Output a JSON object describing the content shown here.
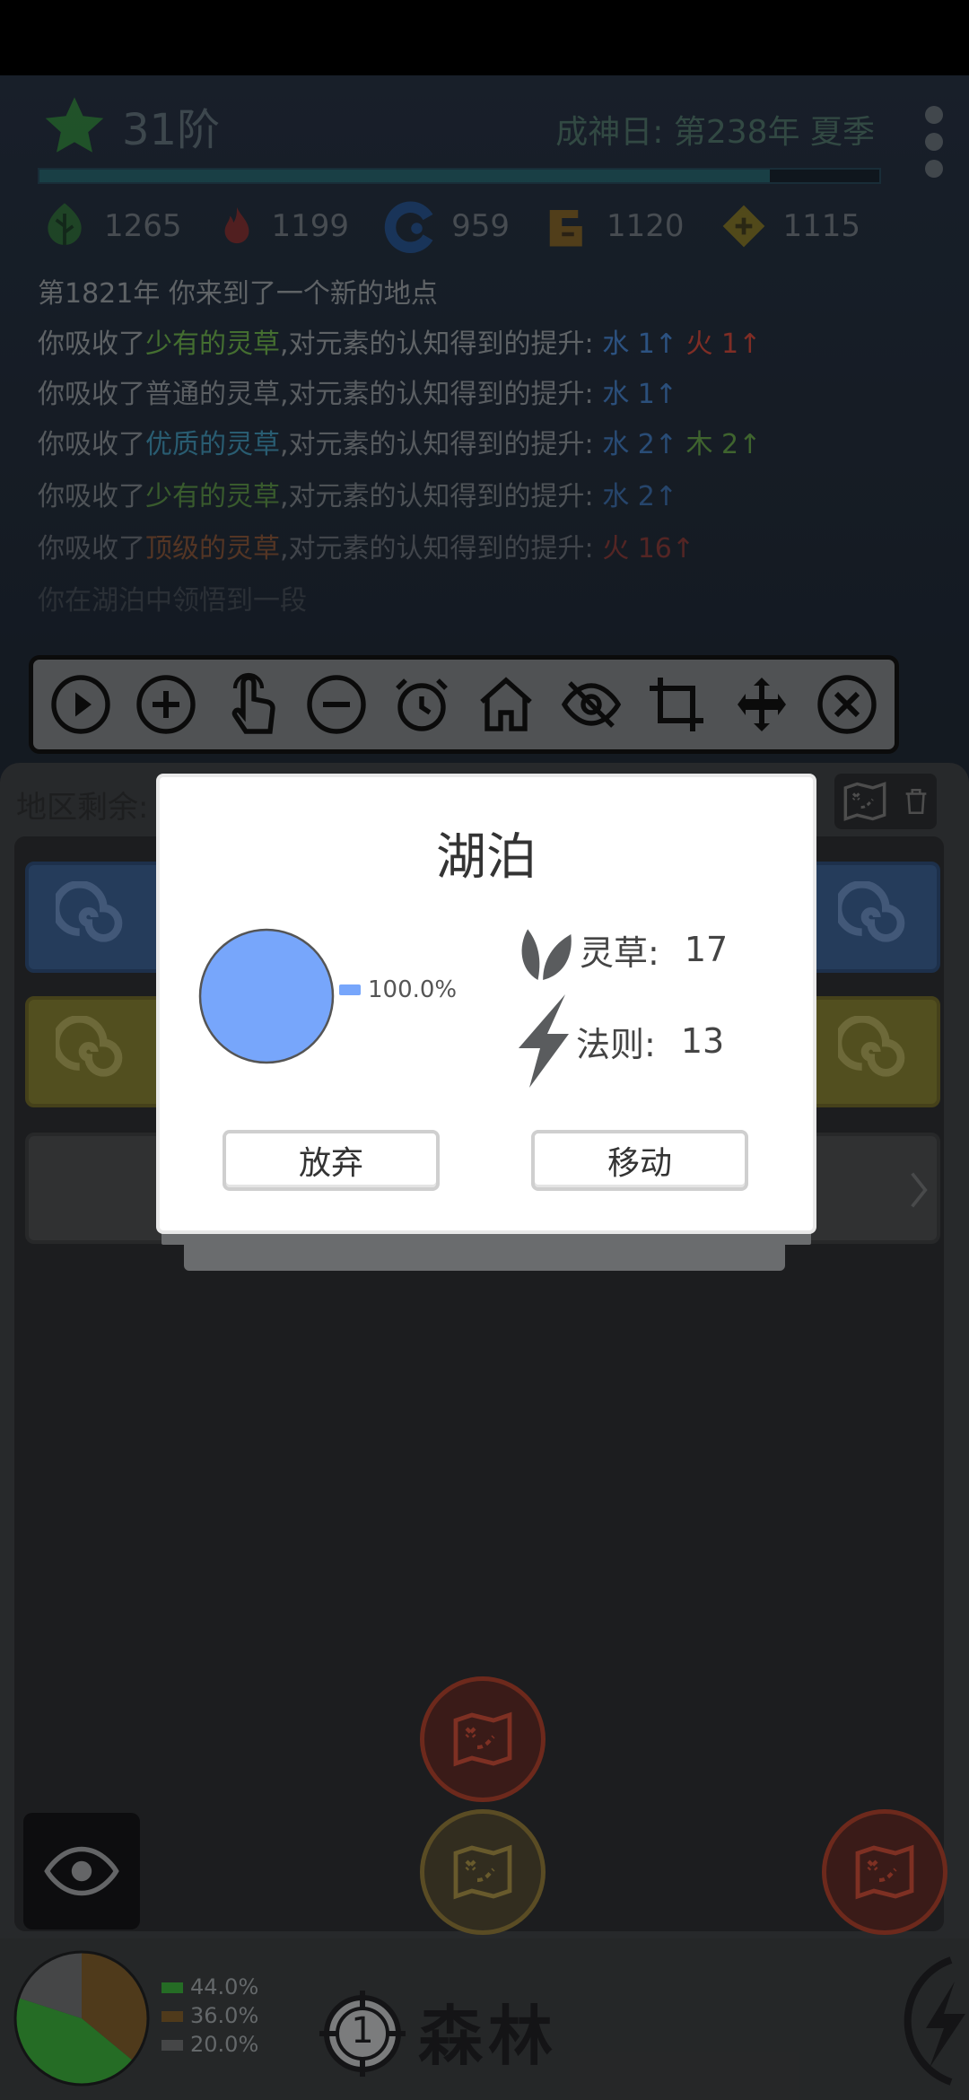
{
  "header": {
    "rank_label": "31阶",
    "date_label": "成神日: 第238年 夏季",
    "progress": 0.87
  },
  "resources": [
    {
      "icon": "green-leaf-icon",
      "value": "1265",
      "color": "#3a9a3a"
    },
    {
      "icon": "red-flame-icon",
      "value": "1199",
      "color": "#c7322a"
    },
    {
      "icon": "blue-water-icon",
      "value": "959",
      "color": "#2a6fc7"
    },
    {
      "icon": "orange-earth-icon",
      "value": "1120",
      "color": "#c78a1a"
    },
    {
      "icon": "yellow-diamond-icon",
      "value": "1115",
      "color": "#c7a91a"
    }
  ],
  "log": [
    {
      "parts": [
        {
          "t": "第1821年 你来到了一个新的地点",
          "c": ""
        }
      ]
    },
    {
      "parts": [
        {
          "t": "你吸收了",
          "c": ""
        },
        {
          "t": "少有的灵草",
          "c": "g"
        },
        {
          "t": ",对元素的认知得到的提升: ",
          "c": ""
        },
        {
          "t": "水 1↑ ",
          "c": "b"
        },
        {
          "t": "火 1↑",
          "c": "r"
        }
      ]
    },
    {
      "parts": [
        {
          "t": "你吸收了",
          "c": ""
        },
        {
          "t": "普通的灵草",
          "c": ""
        },
        {
          "t": ",对元素的认知得到的提升: ",
          "c": ""
        },
        {
          "t": "水 1↑",
          "c": "b"
        }
      ]
    },
    {
      "parts": [
        {
          "t": "你吸收了",
          "c": ""
        },
        {
          "t": "优质的灵草",
          "c": "c"
        },
        {
          "t": ",对元素的认知得到的提升: ",
          "c": ""
        },
        {
          "t": "水 2↑ ",
          "c": "b"
        },
        {
          "t": "木 2↑",
          "c": "g"
        }
      ]
    },
    {
      "parts": [
        {
          "t": "你吸收了",
          "c": ""
        },
        {
          "t": "少有的灵草",
          "c": "g"
        },
        {
          "t": ",对元素的认知得到的提升: ",
          "c": ""
        },
        {
          "t": "水 2↑",
          "c": "b"
        }
      ]
    },
    {
      "parts": [
        {
          "t": "你吸收了",
          "c": ""
        },
        {
          "t": "顶级的灵草",
          "c": "o"
        },
        {
          "t": ",对元素的认知得到的提升: ",
          "c": ""
        },
        {
          "t": "火 16↑",
          "c": "r"
        }
      ]
    },
    {
      "parts": [
        {
          "t": "你在湖泊中领悟到一段",
          "c": ""
        }
      ]
    }
  ],
  "toolbar": [
    "play-icon",
    "plus-icon",
    "tap-icon",
    "minus-icon",
    "alarm-icon",
    "home-icon",
    "eye-off-icon",
    "crop-icon",
    "move-icon",
    "close-icon"
  ],
  "panel": {
    "region_label": "地区剩余:"
  },
  "dialog": {
    "title": "湖泊",
    "pie_percent": "100.0%",
    "pie_color": "#77a6fb",
    "herb_label": "灵草:",
    "herb_value": "17",
    "law_label": "法则:",
    "law_value": "13",
    "abandon_label": "放弃",
    "move_label": "移动"
  },
  "bottom": {
    "legend": [
      {
        "pct": "44.0%",
        "color": "#3aa63a"
      },
      {
        "pct": "36.0%",
        "color": "#7a5a2a"
      },
      {
        "pct": "20.0%",
        "color": "#6a6c6e"
      }
    ],
    "target_number": "1",
    "area_name": "森林"
  }
}
